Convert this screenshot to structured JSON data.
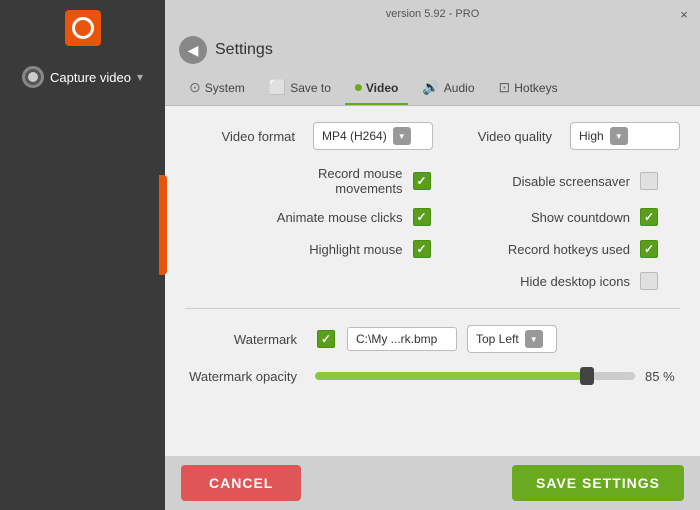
{
  "window": {
    "title": "version 5.92 - PRO",
    "close_label": "×"
  },
  "sidebar": {
    "capture_label": "Capture video",
    "chevron": "▾"
  },
  "settings": {
    "back_label": "◀",
    "title": "Settings"
  },
  "tabs": [
    {
      "id": "system",
      "label": "System",
      "icon": "⊙"
    },
    {
      "id": "save_to",
      "label": "Save to",
      "icon": "⬜"
    },
    {
      "id": "video",
      "label": "Video",
      "icon": "⏺",
      "active": true
    },
    {
      "id": "audio",
      "label": "Audio",
      "icon": "🔊"
    },
    {
      "id": "hotkeys",
      "label": "Hotkeys",
      "icon": "⊡"
    }
  ],
  "video_settings": {
    "format_label": "Video format",
    "format_value": "MP4 (H264)",
    "quality_label": "Video quality",
    "quality_value": "High",
    "options": [
      {
        "label": "Record mouse movements",
        "checked": true,
        "side": "left"
      },
      {
        "label": "Disable screensaver",
        "checked": false,
        "side": "right"
      },
      {
        "label": "Animate mouse clicks",
        "checked": true,
        "side": "left"
      },
      {
        "label": "Show countdown",
        "checked": true,
        "side": "right"
      },
      {
        "label": "Highlight mouse",
        "checked": true,
        "side": "left"
      },
      {
        "label": "Record hotkeys used",
        "checked": true,
        "side": "right"
      },
      {
        "label": "Hide desktop icons",
        "checked": false,
        "side": "right"
      }
    ],
    "watermark_label": "Watermark",
    "watermark_checked": true,
    "watermark_path": "C:\\My ...rk.bmp",
    "watermark_position": "Top Left",
    "opacity_label": "Watermark opacity",
    "opacity_value": "85 %",
    "opacity_percent": 85
  },
  "footer": {
    "cancel_label": "CANCEL",
    "save_label": "SAVE SETTINGS"
  }
}
